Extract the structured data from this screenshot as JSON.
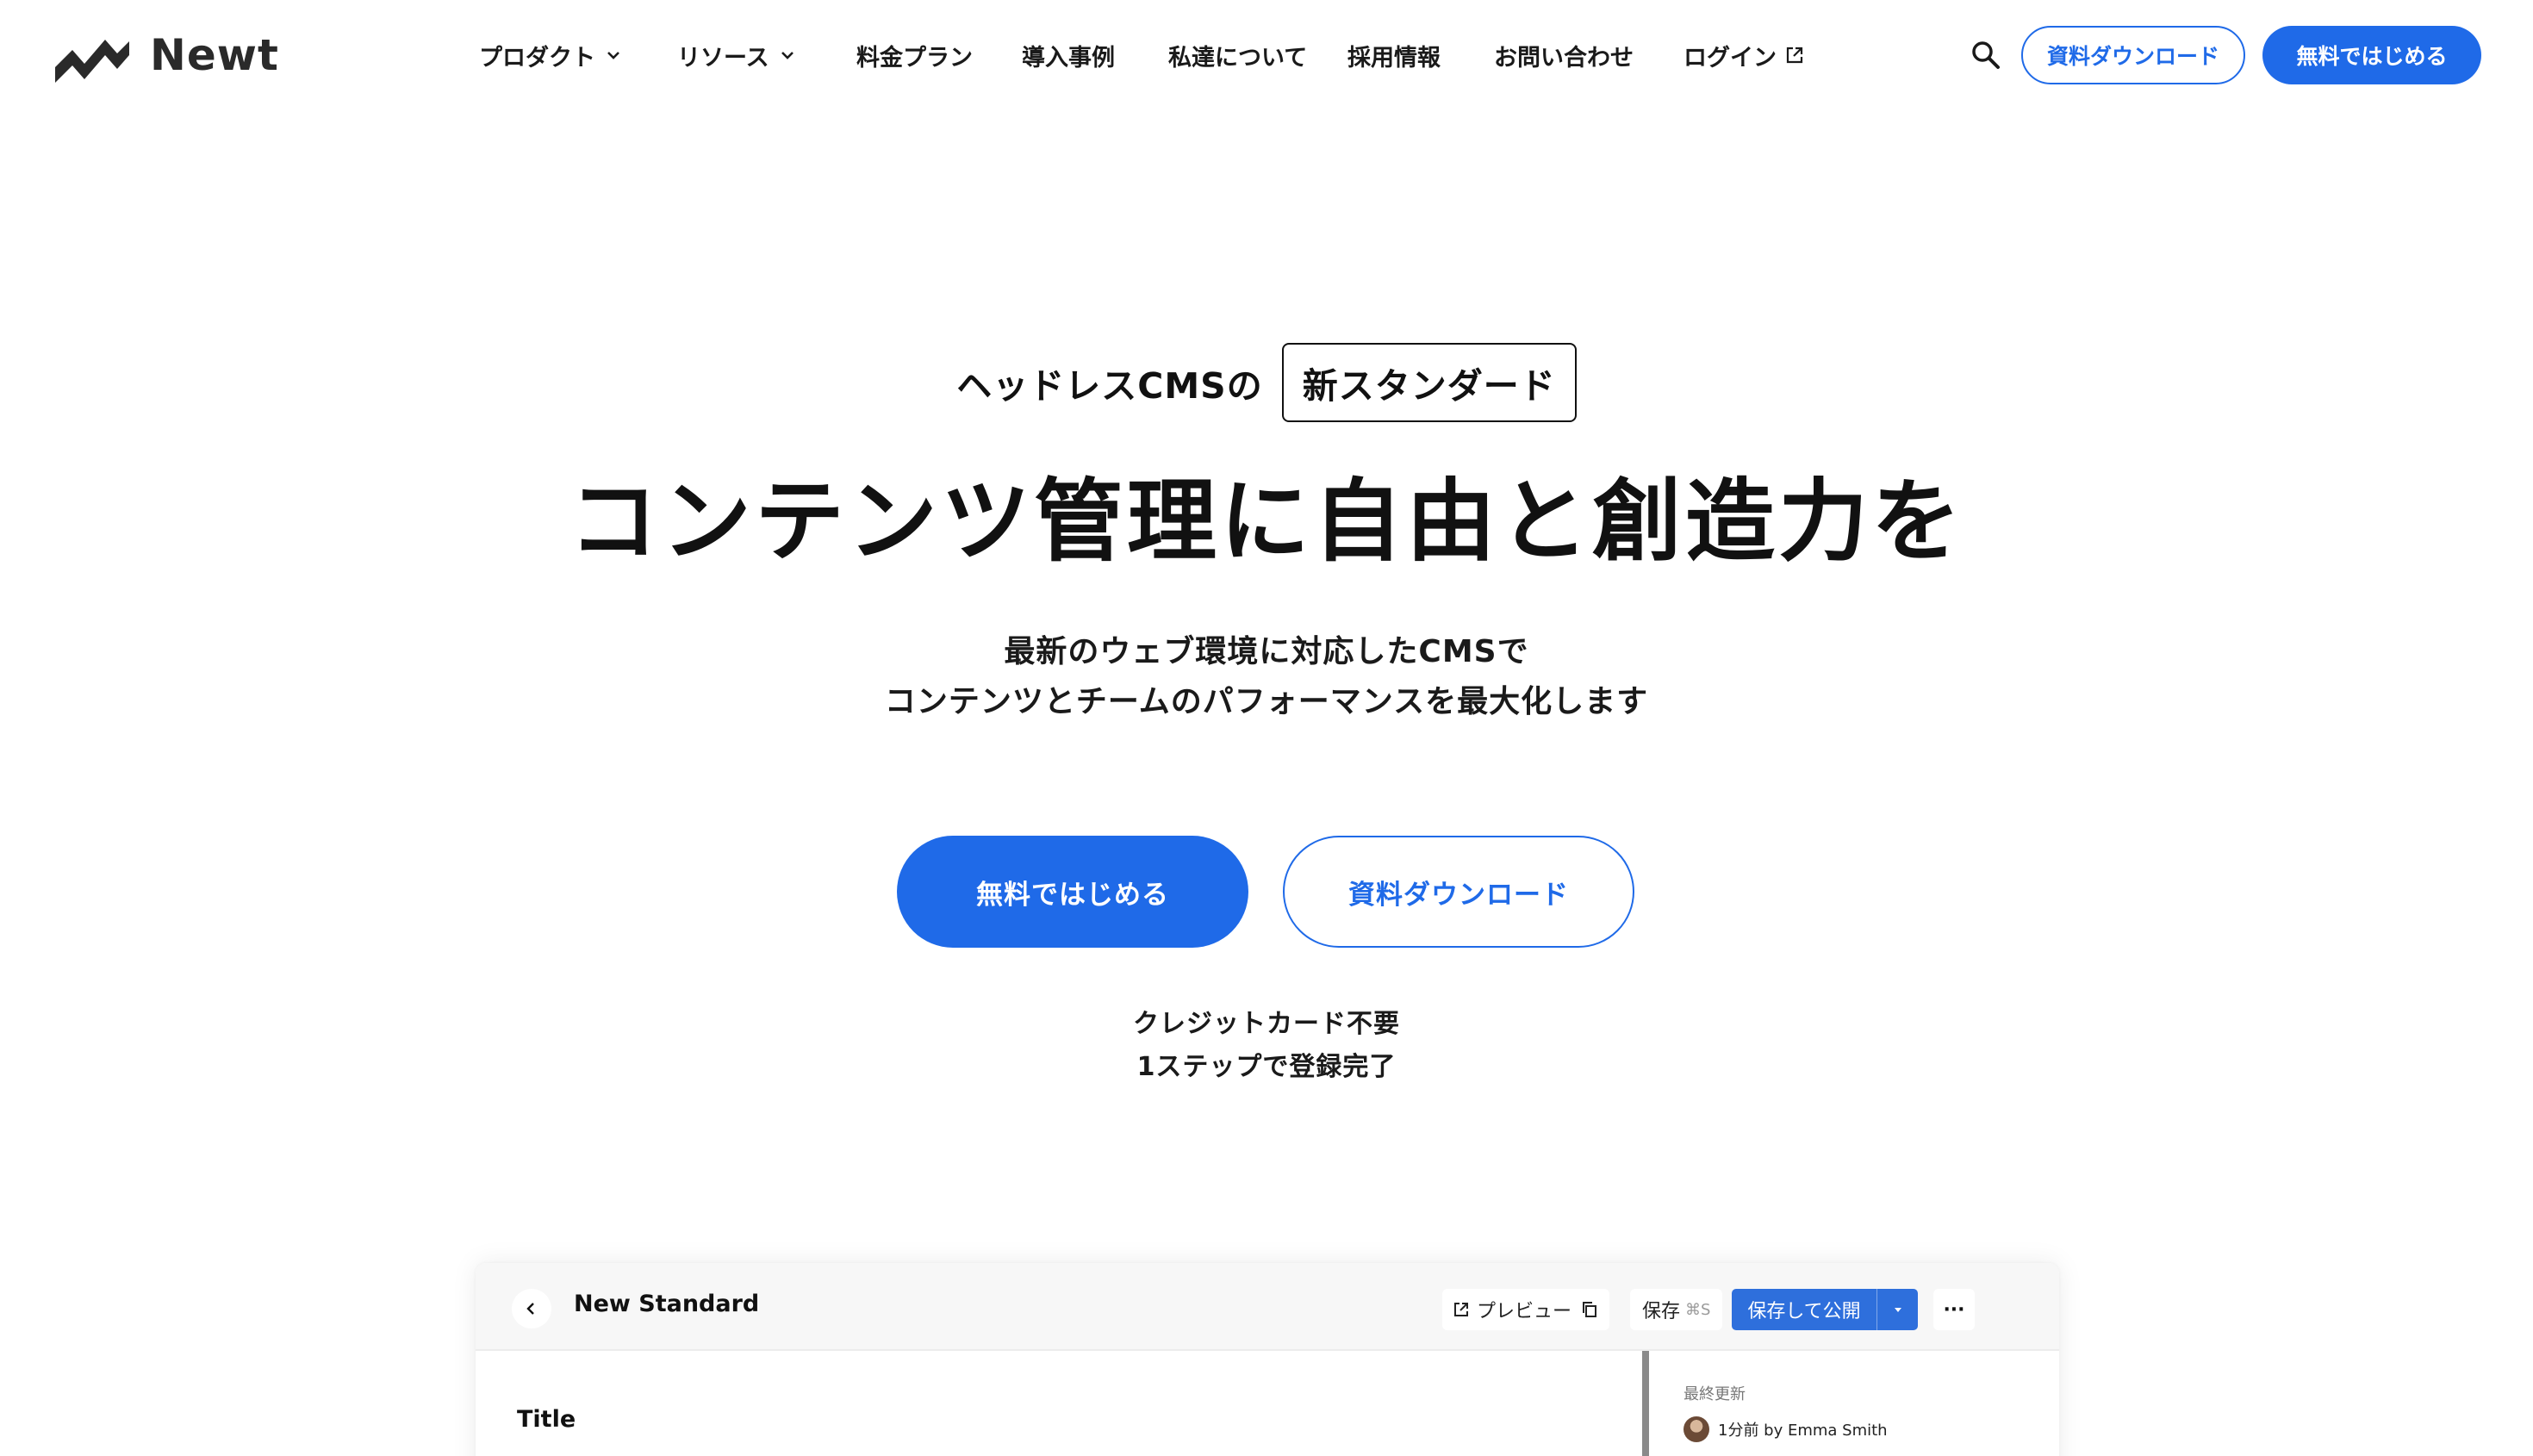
{
  "brand": {
    "name": "Newt"
  },
  "nav": {
    "items": [
      {
        "label": "プロダクト",
        "icon": "chevron-down-icon"
      },
      {
        "label": "リソース",
        "icon": "chevron-down-icon"
      },
      {
        "label": "料金プラン"
      },
      {
        "label": "導入事例"
      },
      {
        "label": "私達について"
      },
      {
        "label": "採用情報"
      },
      {
        "label": "お問い合わせ"
      },
      {
        "label": "ログイン",
        "icon": "external-link-icon"
      }
    ],
    "download_label": "資料ダウンロード",
    "start_label": "無料ではじめる"
  },
  "hero": {
    "eyebrow": "ヘッドレスCMSの",
    "eyebrow_badge": "新スタンダード",
    "title": "コンテンツ管理に自由と創造力を",
    "subtitle_line1": "最新のウェブ環境に対応したCMSで",
    "subtitle_line2": "コンテンツとチームのパフォーマンスを最大化します",
    "cta_primary": "無料ではじめる",
    "cta_secondary": "資料ダウンロード",
    "note_line1": "クレジットカード不要",
    "note_line2": "1ステップで登録完了"
  },
  "editor": {
    "doc_title": "New Standard",
    "preview_label": "プレビュー",
    "save_label": "保存",
    "save_shortcut": "⌘S",
    "publish_label": "保存して公開",
    "more_label": "···",
    "field_title": "Title",
    "side_label": "最終更新",
    "side_meta": "1分前 by Emma Smith"
  },
  "colors": {
    "primary": "#1f6ae8",
    "text": "#111111",
    "topbar": "#f7f7f7"
  }
}
